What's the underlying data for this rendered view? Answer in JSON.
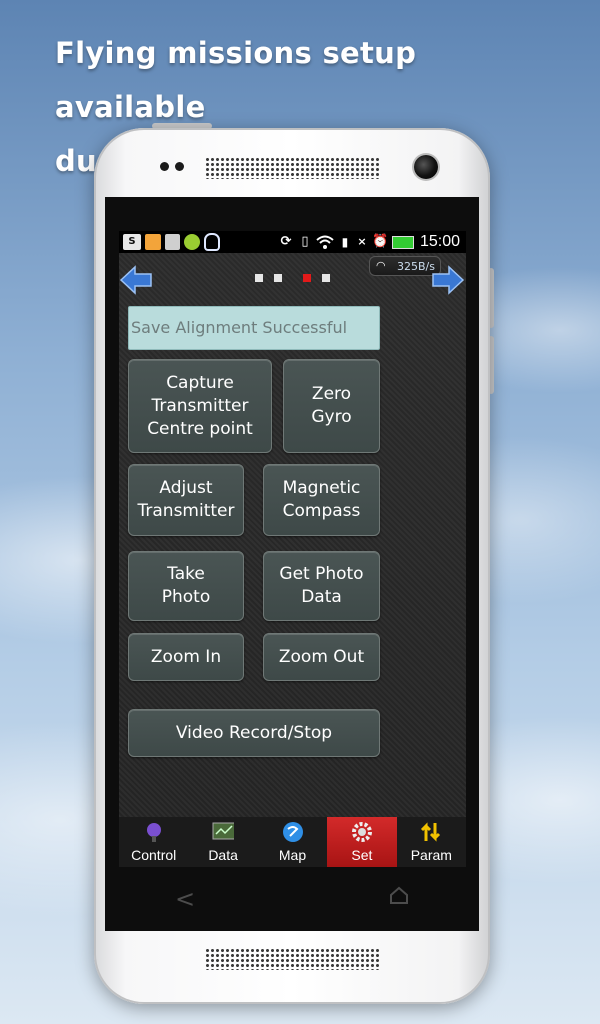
{
  "headline": {
    "line1": "Flying missions setup available",
    "line2": "during flying process"
  },
  "statusbar": {
    "time": "15:00",
    "left_icons": [
      "sim-icon",
      "notification-icon",
      "gallery-icon",
      "app-icon",
      "qq-icon"
    ],
    "right_icons": [
      "rotate-icon",
      "vibrate-icon",
      "wifi-icon",
      "mobile-data-icon",
      "signal-off-icon",
      "alarm-icon",
      "battery-icon"
    ]
  },
  "toolbar": {
    "speed": "325B/s",
    "pages": 4,
    "active_page": 3
  },
  "status_message": "Save Alignment Successful",
  "buttons": {
    "capture": "Capture\nTransmitter\nCentre point",
    "zero_gyro": "Zero\nGyro",
    "adjust_transmitter": "Adjust\nTransmitter",
    "magnetic_compass": "Magnetic\nCompass",
    "take_photo": "Take\nPhoto",
    "get_photo_data": "Get Photo\nData",
    "zoom_in": "Zoom In",
    "zoom_out": "Zoom Out",
    "video_record": "Video Record/Stop"
  },
  "tabs": [
    {
      "label": "Control",
      "icon": "joystick-icon"
    },
    {
      "label": "Data",
      "icon": "data-monitor-icon"
    },
    {
      "label": "Map",
      "icon": "globe-icon"
    },
    {
      "label": "Set",
      "icon": "gear-icon",
      "active": true
    },
    {
      "label": "Param",
      "icon": "up-down-arrows-icon"
    }
  ],
  "colors": {
    "accent_active_tab": "#c81e1e",
    "status_field_bg": "#b9dcdc",
    "button_bg": "#434e4d"
  }
}
